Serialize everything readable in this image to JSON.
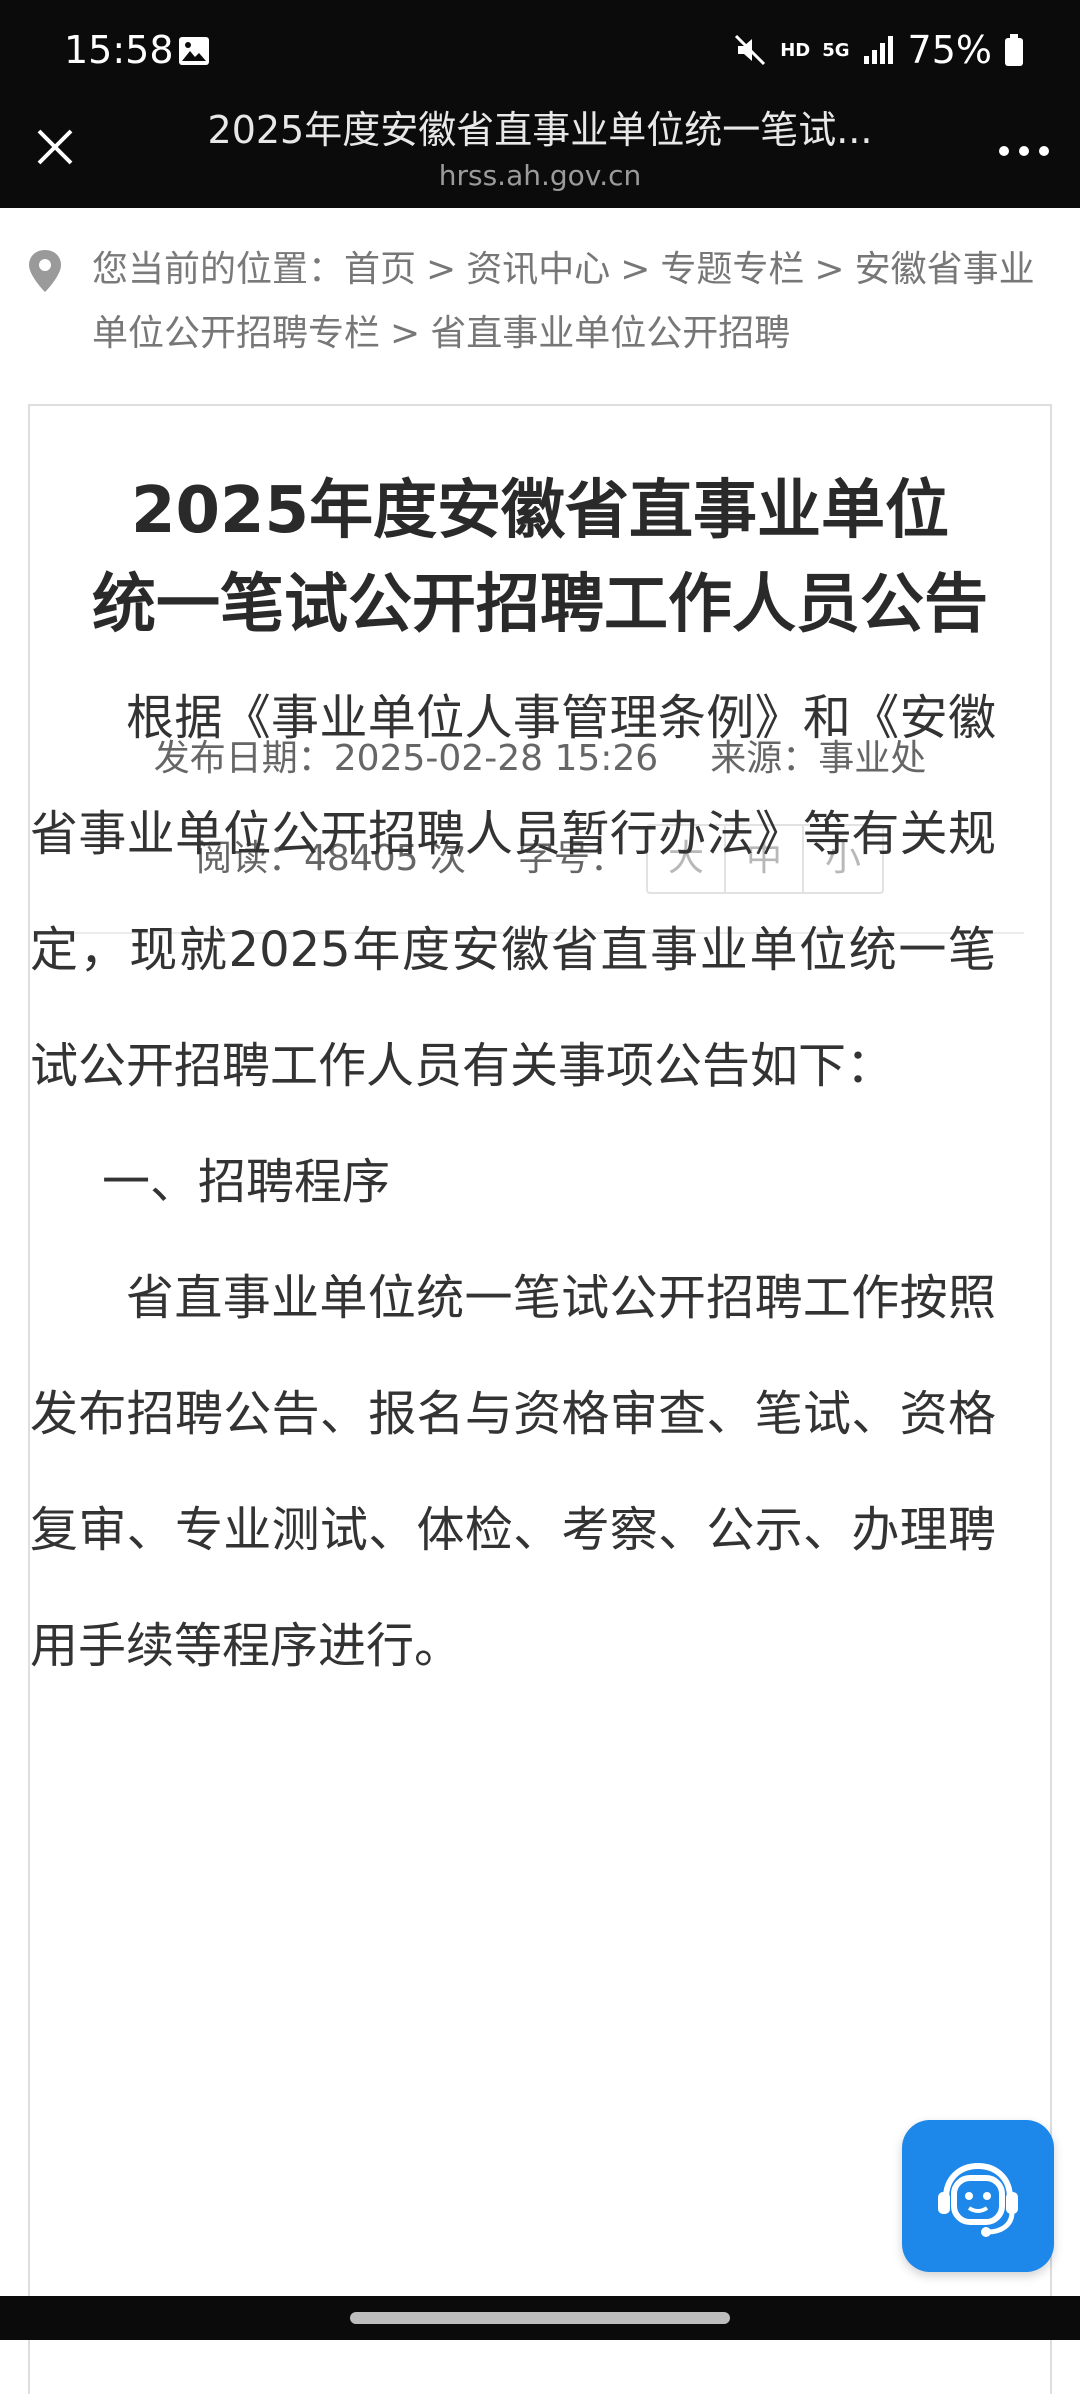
{
  "status_bar": {
    "time": "15:58",
    "network": "5G",
    "hd_label": "HD",
    "battery": "75%",
    "icons": [
      "photo-icon",
      "mute-icon",
      "signal-icon",
      "battery-icon"
    ]
  },
  "browser": {
    "title": "2025年度安徽省直事业单位统一笔试...",
    "url": "hrss.ah.gov.cn",
    "close_icon": "close-icon",
    "more_icon": "more-icon"
  },
  "breadcrumb": {
    "prefix": "您当前的位置：",
    "items": [
      "首页",
      "资讯中心",
      "专题专栏",
      "安徽省事业单位公开招聘专栏",
      "省直事业单位公开招聘"
    ],
    "separator": ">"
  },
  "article": {
    "title_line1": "2025年度安徽省直事业单位",
    "title_line2": "统一笔试公开招聘工作人员公告",
    "publish_label": "发布日期：",
    "publish_date": "2025-02-28 15:26",
    "source_label": "来源：",
    "source": "事业处",
    "read_label": "阅读：",
    "read_count": "48405 次",
    "font_label": "字号：",
    "font_sizes": [
      "大",
      "中",
      "小"
    ],
    "paragraphs": [
      "根据《事业单位人事管理条例》和《安徽省事业单位公开招聘人员暂行办法》等有关规定，现就2025年度安徽省直事业单位统一笔试公开招聘工作人员有关事项公告如下：",
      "一、招聘程序",
      "省直事业单位统一笔试公开招聘工作按照发布招聘公告、报名与资格审查、笔试、资格复审、专业测试、体检、考察、公示、办理聘用手续等程序进行。"
    ]
  },
  "floating": {
    "assistant_icon": "robot-assistant-icon"
  },
  "colors": {
    "top_bar": "#0b0b0b",
    "accent": "#1d87ea",
    "text": "#333333",
    "muted": "#777777"
  }
}
